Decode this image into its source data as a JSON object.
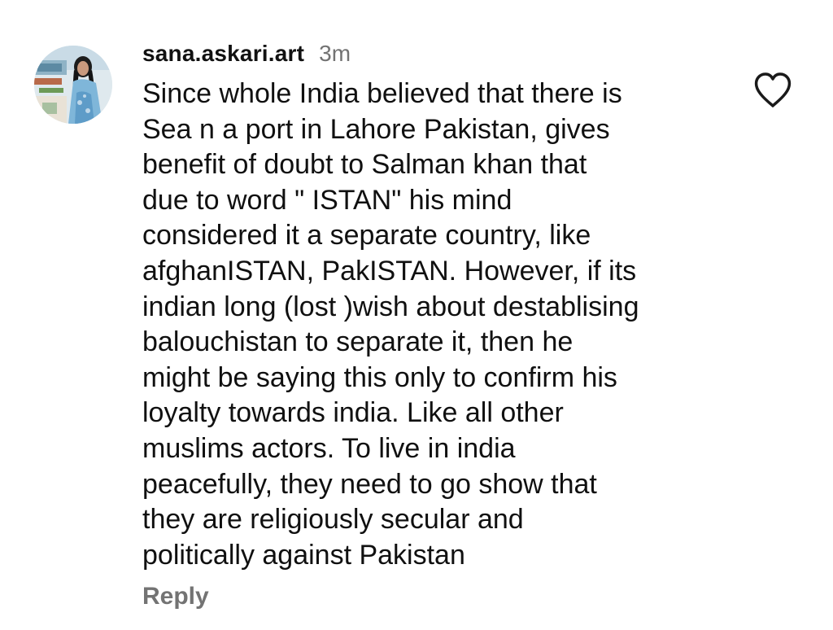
{
  "comment": {
    "username": "sana.askari.art",
    "timestamp": "3m",
    "text": "Since whole India believed that there is\nSea n a port in Lahore Pakistan, gives\nbenefit of doubt to Salman khan that\ndue to word \" ISTAN\" his mind\nconsidered it a separate country, like\nafghanISTAN, PakISTAN. However, if its\nindian long (lost )wish about destablising\nbalouchistan to separate it, then he\nmight be saying this only to confirm his\nloyalty towards india. Like all other\nmuslims actors. To live in india\npeacefully, they need to go show that\nthey are religiously secular and\npolitically against Pakistan",
    "reply_label": "Reply",
    "like_icon": "heart-outline-icon",
    "avatar_icon": "profile-photo"
  },
  "colors": {
    "text": "#101010",
    "muted": "#737373",
    "background": "#ffffff"
  }
}
